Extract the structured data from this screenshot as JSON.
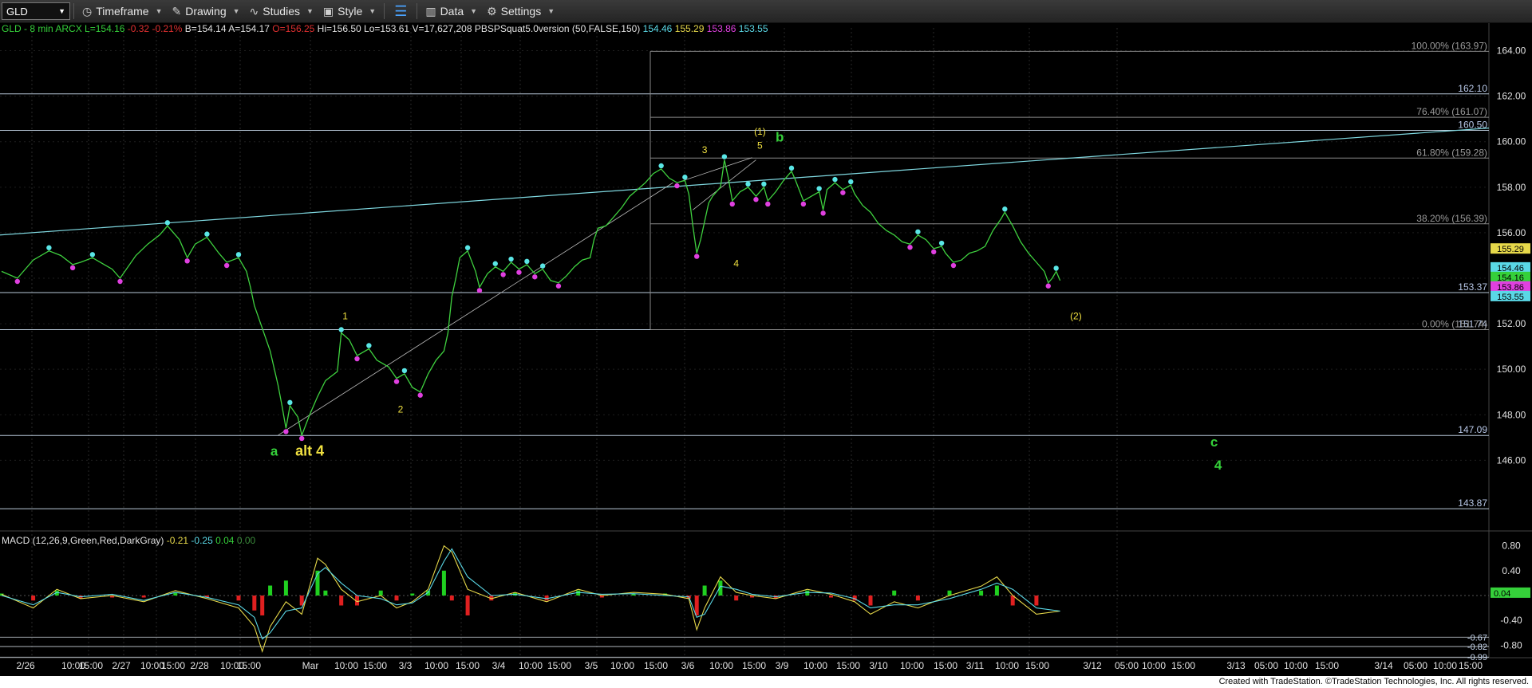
{
  "toolbar": {
    "symbol": "GLD",
    "timeframe": "Timeframe",
    "drawing": "Drawing",
    "studies": "Studies",
    "style": "Style",
    "data": "Data",
    "settings": "Settings"
  },
  "header": [
    {
      "t": "GLD - 8 min ARCX",
      "c": "#35d03a"
    },
    {
      "t": "L=154.16",
      "c": "#35d03a"
    },
    {
      "t": "-0.32",
      "c": "#e03030"
    },
    {
      "t": "-0.21%",
      "c": "#e03030"
    },
    {
      "t": "B=154.14",
      "c": "#e0e0e0"
    },
    {
      "t": "A=154.17",
      "c": "#e0e0e0"
    },
    {
      "t": "O=156.25",
      "c": "#e03030"
    },
    {
      "t": "Hi=156.50",
      "c": "#e0e0e0"
    },
    {
      "t": "Lo=153.61",
      "c": "#e0e0e0"
    },
    {
      "t": "V=17,627,208",
      "c": "#e0e0e0"
    },
    {
      "t": "PBSPSquat5.0version (50,FALSE,150)",
      "c": "#e0e0e0"
    },
    {
      "t": "154.46",
      "c": "#5ad8e6"
    },
    {
      "t": "155.29",
      "c": "#e6d84a"
    },
    {
      "t": "153.86",
      "c": "#e040e0"
    },
    {
      "t": "153.55",
      "c": "#5ad8e6"
    }
  ],
  "macd_header": [
    {
      "t": "MACD (12,26,9,Green,Red,DarkGray)",
      "c": "#e0e0e0"
    },
    {
      "t": "-0.21",
      "c": "#e6d84a"
    },
    {
      "t": "-0.25",
      "c": "#5ad8e6"
    },
    {
      "t": "0.04",
      "c": "#35d03a"
    },
    {
      "t": "0.00",
      "c": "#3a8a3a"
    }
  ],
  "chart_data": {
    "type": "line",
    "ylim": [
      143.0,
      165.0
    ],
    "y_ticks": [
      146.0,
      148.0,
      150.0,
      152.0,
      154.0,
      156.0,
      158.0,
      160.0,
      162.0,
      164.0
    ],
    "x_ticks": [
      "2/26",
      "10:00",
      "15:00",
      "2/27",
      "10:00",
      "15:00",
      "2/28",
      "10:00",
      "15:00",
      "Mar",
      "10:00",
      "15:00",
      "3/3",
      "10:00",
      "15:00",
      "3/4",
      "10:00",
      "15:00",
      "3/5",
      "10:00",
      "15:00",
      "3/6",
      "10:00",
      "15:00",
      "3/9",
      "10:00",
      "15:00",
      "3/10",
      "10:00",
      "15:00",
      "3/11",
      "10:00",
      "15:00",
      "3/12",
      "05:00",
      "10:00",
      "15:00",
      "3/13",
      "05:00",
      "10:00",
      "15:00",
      "3/14",
      "05:00",
      "10:00",
      "15:00"
    ],
    "price": {
      "colors": {
        "line": "#3fd13f",
        "cyan": "#5ae6e6",
        "magenta": "#e040e0"
      },
      "points": [
        [
          0,
          154.3
        ],
        [
          4,
          154.0
        ],
        [
          8,
          154.8
        ],
        [
          12,
          155.2
        ],
        [
          15,
          155.0
        ],
        [
          18,
          154.6
        ],
        [
          20,
          154.7
        ],
        [
          23,
          154.9
        ],
        [
          26,
          154.6
        ],
        [
          28,
          154.4
        ],
        [
          30,
          154.0
        ],
        [
          34,
          155.0
        ],
        [
          37,
          155.5
        ],
        [
          40,
          155.9
        ],
        [
          42,
          156.3
        ],
        [
          45,
          155.7
        ],
        [
          47,
          154.9
        ],
        [
          49,
          155.5
        ],
        [
          52,
          155.8
        ],
        [
          55,
          155.1
        ],
        [
          57,
          154.7
        ],
        [
          60,
          154.9
        ],
        [
          62,
          154.3
        ],
        [
          63,
          153.6
        ],
        [
          64,
          152.8
        ],
        [
          66,
          151.8
        ],
        [
          68,
          150.8
        ],
        [
          70,
          149.3
        ],
        [
          71,
          148.4
        ],
        [
          72,
          147.4
        ],
        [
          73,
          148.4
        ],
        [
          75,
          147.9
        ],
        [
          76,
          147.1
        ],
        [
          78,
          148.0
        ],
        [
          80,
          148.8
        ],
        [
          82,
          149.5
        ],
        [
          85,
          149.9
        ],
        [
          86,
          151.6
        ],
        [
          88,
          151.3
        ],
        [
          90,
          150.6
        ],
        [
          93,
          150.9
        ],
        [
          95,
          150.4
        ],
        [
          98,
          150.1
        ],
        [
          100,
          149.6
        ],
        [
          102,
          149.8
        ],
        [
          104,
          149.2
        ],
        [
          106,
          149.0
        ],
        [
          108,
          149.8
        ],
        [
          110,
          150.4
        ],
        [
          112,
          150.8
        ],
        [
          113,
          151.6
        ],
        [
          114,
          153.2
        ],
        [
          115,
          154.0
        ],
        [
          116,
          154.9
        ],
        [
          118,
          155.2
        ],
        [
          120,
          154.3
        ],
        [
          121,
          153.6
        ],
        [
          123,
          154.2
        ],
        [
          125,
          154.5
        ],
        [
          127,
          154.3
        ],
        [
          129,
          154.7
        ],
        [
          131,
          154.4
        ],
        [
          133,
          154.6
        ],
        [
          135,
          154.2
        ],
        [
          137,
          154.4
        ],
        [
          139,
          153.9
        ],
        [
          141,
          153.8
        ],
        [
          143,
          154.1
        ],
        [
          145,
          154.5
        ],
        [
          147,
          154.8
        ],
        [
          149,
          154.9
        ],
        [
          150,
          155.7
        ],
        [
          151,
          156.2
        ],
        [
          153,
          156.3
        ],
        [
          155,
          156.7
        ],
        [
          157,
          157.1
        ],
        [
          159,
          157.6
        ],
        [
          161,
          157.9
        ],
        [
          163,
          158.2
        ],
        [
          165,
          158.6
        ],
        [
          167,
          158.8
        ],
        [
          169,
          158.4
        ],
        [
          171,
          158.2
        ],
        [
          173,
          158.3
        ],
        [
          174,
          157.7
        ],
        [
          175,
          156.3
        ],
        [
          176,
          155.1
        ],
        [
          177,
          155.7
        ],
        [
          178,
          156.5
        ],
        [
          179,
          157.3
        ],
        [
          180,
          157.6
        ],
        [
          182,
          158.0
        ],
        [
          183,
          159.2
        ],
        [
          184,
          158.4
        ],
        [
          185,
          157.4
        ],
        [
          187,
          157.8
        ],
        [
          189,
          158.0
        ],
        [
          191,
          157.6
        ],
        [
          193,
          158.0
        ],
        [
          194,
          157.4
        ],
        [
          196,
          157.8
        ],
        [
          198,
          158.3
        ],
        [
          200,
          158.7
        ],
        [
          201,
          158.3
        ],
        [
          203,
          157.4
        ],
        [
          205,
          157.6
        ],
        [
          207,
          157.8
        ],
        [
          208,
          157.0
        ],
        [
          209,
          157.9
        ],
        [
          211,
          158.2
        ],
        [
          213,
          157.9
        ],
        [
          215,
          158.1
        ],
        [
          216,
          157.7
        ],
        [
          218,
          157.2
        ],
        [
          220,
          156.9
        ],
        [
          222,
          156.4
        ],
        [
          224,
          156.1
        ],
        [
          226,
          155.9
        ],
        [
          228,
          155.6
        ],
        [
          230,
          155.5
        ],
        [
          232,
          155.9
        ],
        [
          234,
          155.7
        ],
        [
          236,
          155.3
        ],
        [
          238,
          155.4
        ],
        [
          239,
          155.1
        ],
        [
          241,
          154.7
        ],
        [
          243,
          154.8
        ],
        [
          245,
          155.1
        ],
        [
          247,
          155.2
        ],
        [
          249,
          155.4
        ],
        [
          251,
          156.1
        ],
        [
          253,
          156.6
        ],
        [
          254,
          156.9
        ],
        [
          256,
          156.3
        ],
        [
          258,
          155.6
        ],
        [
          260,
          155.1
        ],
        [
          262,
          154.7
        ],
        [
          264,
          154.3
        ],
        [
          265,
          153.8
        ],
        [
          266,
          154.0
        ],
        [
          267,
          154.3
        ],
        [
          268,
          153.9
        ]
      ]
    },
    "h_lines": [
      {
        "y": 162.1,
        "label": "162.10"
      },
      {
        "y": 160.5,
        "label": "160.50"
      },
      {
        "y": 153.37,
        "label": "153.37"
      },
      {
        "y": 151.74,
        "label": "151.74"
      },
      {
        "y": 147.09,
        "label": "147.09"
      },
      {
        "y": 143.87,
        "label": "143.87"
      }
    ],
    "fib": [
      {
        "y": 163.97,
        "label": "100.00% (163.97)"
      },
      {
        "y": 161.07,
        "label": "76.40% (161.07)"
      },
      {
        "y": 159.28,
        "label": "61.80% (159.28)"
      },
      {
        "y": 156.39,
        "label": "38.20% (156.39)"
      },
      {
        "y": 151.74,
        "label": "0.00% (151.74)"
      }
    ],
    "right_tags": [
      {
        "y": 155.29,
        "label": "155.29",
        "bg": "#e6d84a"
      },
      {
        "y": 154.46,
        "label": "154.46",
        "bg": "#5ad8e6"
      },
      {
        "y": 154.16,
        "label": "154.16",
        "bg": "#35d03a"
      },
      {
        "y": 153.86,
        "label": "153.86",
        "bg": "#e040e0"
      },
      {
        "y": 153.55,
        "label": "153.55",
        "bg": "#5ad8e6"
      }
    ],
    "annotations": [
      {
        "x": 69,
        "y": 146.2,
        "text": "a",
        "color": "#35d03a",
        "size": 17
      },
      {
        "x": 78,
        "y": 146.2,
        "text": "alt 4",
        "color": "#f0e040",
        "size": 18
      },
      {
        "x": 87,
        "y": 152.2,
        "text": "1",
        "color": "#f0e040",
        "size": 12
      },
      {
        "x": 101,
        "y": 148.1,
        "text": "2",
        "color": "#f0e040",
        "size": 12
      },
      {
        "x": 178,
        "y": 159.5,
        "text": "3",
        "color": "#f0e040",
        "size": 12
      },
      {
        "x": 186,
        "y": 154.5,
        "text": "4",
        "color": "#f0e040",
        "size": 12
      },
      {
        "x": 192,
        "y": 159.7,
        "text": "5",
        "color": "#f0e040",
        "size": 12
      },
      {
        "x": 192,
        "y": 160.3,
        "text": "(1)",
        "color": "#f0e040",
        "size": 12
      },
      {
        "x": 197,
        "y": 160.0,
        "text": "b",
        "color": "#35d03a",
        "size": 17
      },
      {
        "x": 272,
        "y": 152.2,
        "text": "(2)",
        "color": "#f0e040",
        "size": 12
      },
      {
        "x": 307,
        "y": 146.6,
        "text": "c",
        "color": "#35d03a",
        "size": 17
      },
      {
        "x": 308,
        "y": 145.6,
        "text": "4",
        "color": "#35d03a",
        "size": 17
      }
    ],
    "macd": {
      "ylim": [
        -1.0,
        1.0
      ],
      "y_ticks": [
        0.8,
        0.4,
        0.0,
        -0.4,
        -0.8
      ],
      "y_tick_labels": [
        "0.80",
        "0.40",
        "",
        "-0.40",
        "-0.80"
      ],
      "tags": [
        {
          "y": 0.04,
          "label": "0.04",
          "bg": "#35d03a"
        },
        {
          "y": -0.67,
          "label": "-0.67",
          "bg": ""
        },
        {
          "y": -0.82,
          "label": "-0.82",
          "bg": ""
        },
        {
          "y": -0.99,
          "label": "-0.99",
          "bg": ""
        }
      ],
      "h_lines": [
        -0.67,
        -0.82,
        -0.99
      ],
      "macd_points": [
        [
          0,
          0.02
        ],
        [
          8,
          -0.2
        ],
        [
          14,
          0.1
        ],
        [
          20,
          -0.05
        ],
        [
          28,
          0.0
        ],
        [
          36,
          -0.1
        ],
        [
          44,
          0.08
        ],
        [
          52,
          -0.05
        ],
        [
          60,
          -0.2
        ],
        [
          64,
          -0.5
        ],
        [
          66,
          -0.9
        ],
        [
          68,
          -0.5
        ],
        [
          72,
          -0.1
        ],
        [
          76,
          -0.3
        ],
        [
          80,
          0.6
        ],
        [
          82,
          0.5
        ],
        [
          86,
          0.1
        ],
        [
          90,
          -0.1
        ],
        [
          96,
          0.0
        ],
        [
          100,
          -0.2
        ],
        [
          104,
          -0.1
        ],
        [
          108,
          0.1
        ],
        [
          112,
          0.8
        ],
        [
          114,
          0.7
        ],
        [
          118,
          0.1
        ],
        [
          124,
          -0.05
        ],
        [
          130,
          0.05
        ],
        [
          138,
          -0.1
        ],
        [
          146,
          0.1
        ],
        [
          152,
          0.0
        ],
        [
          160,
          0.05
        ],
        [
          168,
          0.02
        ],
        [
          174,
          -0.05
        ],
        [
          176,
          -0.55
        ],
        [
          178,
          -0.2
        ],
        [
          182,
          0.3
        ],
        [
          186,
          0.05
        ],
        [
          190,
          0.0
        ],
        [
          196,
          -0.05
        ],
        [
          204,
          0.1
        ],
        [
          210,
          0.02
        ],
        [
          216,
          -0.1
        ],
        [
          220,
          -0.3
        ],
        [
          226,
          -0.1
        ],
        [
          232,
          -0.2
        ],
        [
          240,
          0.0
        ],
        [
          248,
          0.15
        ],
        [
          252,
          0.3
        ],
        [
          256,
          0.0
        ],
        [
          262,
          -0.3
        ],
        [
          268,
          -0.25
        ]
      ],
      "signal_points": [
        [
          0,
          0.0
        ],
        [
          8,
          -0.15
        ],
        [
          14,
          0.05
        ],
        [
          20,
          -0.02
        ],
        [
          28,
          0.02
        ],
        [
          36,
          -0.08
        ],
        [
          44,
          0.05
        ],
        [
          52,
          -0.03
        ],
        [
          60,
          -0.15
        ],
        [
          64,
          -0.35
        ],
        [
          66,
          -0.7
        ],
        [
          68,
          -0.6
        ],
        [
          72,
          -0.25
        ],
        [
          76,
          -0.2
        ],
        [
          80,
          0.35
        ],
        [
          82,
          0.45
        ],
        [
          86,
          0.2
        ],
        [
          90,
          0.0
        ],
        [
          96,
          -0.05
        ],
        [
          100,
          -0.15
        ],
        [
          104,
          -0.12
        ],
        [
          108,
          0.05
        ],
        [
          112,
          0.55
        ],
        [
          114,
          0.75
        ],
        [
          118,
          0.3
        ],
        [
          124,
          0.0
        ],
        [
          130,
          0.02
        ],
        [
          138,
          -0.05
        ],
        [
          146,
          0.05
        ],
        [
          152,
          0.02
        ],
        [
          160,
          0.03
        ],
        [
          168,
          0.0
        ],
        [
          174,
          -0.02
        ],
        [
          176,
          -0.35
        ],
        [
          178,
          -0.3
        ],
        [
          182,
          0.15
        ],
        [
          186,
          0.1
        ],
        [
          190,
          0.02
        ],
        [
          196,
          -0.02
        ],
        [
          204,
          0.05
        ],
        [
          210,
          0.04
        ],
        [
          216,
          -0.05
        ],
        [
          220,
          -0.2
        ],
        [
          226,
          -0.15
        ],
        [
          232,
          -0.15
        ],
        [
          240,
          -0.05
        ],
        [
          248,
          0.1
        ],
        [
          252,
          0.2
        ],
        [
          256,
          0.1
        ],
        [
          262,
          -0.2
        ],
        [
          268,
          -0.25
        ]
      ]
    }
  },
  "credit": "Created with TradeStation. ©TradeStation Technologies, Inc. All rights reserved."
}
